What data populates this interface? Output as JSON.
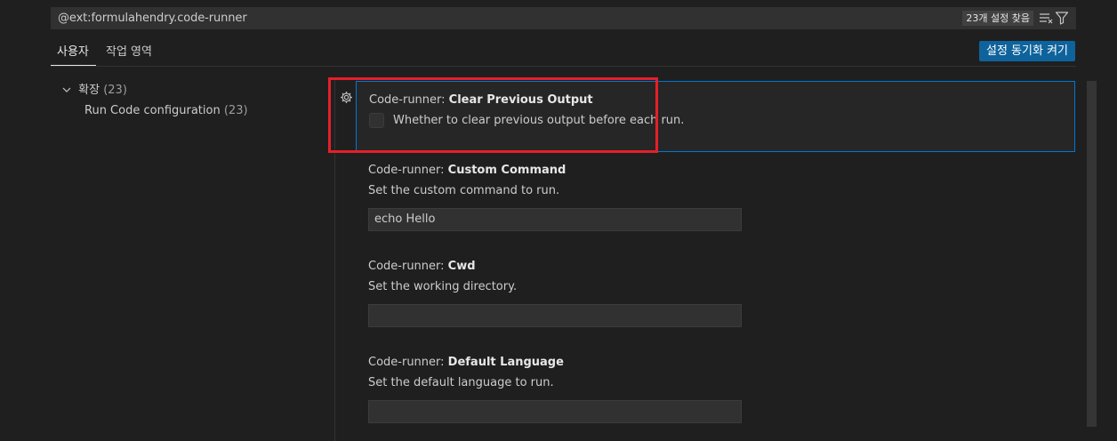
{
  "search": {
    "value": "@ext:formulahendry.code-runner",
    "result_count": "23개 설정 찾음"
  },
  "tabs": [
    {
      "label": "사용자",
      "active": true
    },
    {
      "label": "작업 영역",
      "active": false
    }
  ],
  "sync_button_label": "설정 동기화 켜기",
  "toc": {
    "group_label": "확장",
    "group_count": "(23)",
    "item_label": "Run Code configuration",
    "item_count": "(23)"
  },
  "settings": [
    {
      "category": "Code-runner: ",
      "name": "Clear Previous Output",
      "description": "Whether to clear previous output before each run.",
      "type": "checkbox",
      "checked": false
    },
    {
      "category": "Code-runner: ",
      "name": "Custom Command",
      "description": "Set the custom command to run.",
      "type": "text",
      "value": "echo Hello"
    },
    {
      "category": "Code-runner: ",
      "name": "Cwd",
      "description": "Set the working directory.",
      "type": "text",
      "value": ""
    },
    {
      "category": "Code-runner: ",
      "name": "Default Language",
      "description": "Set the default language to run.",
      "type": "text",
      "value": ""
    }
  ],
  "colors": {
    "accent": "#0078d4",
    "button": "#0e639c",
    "highlight": "#e51f2a"
  }
}
